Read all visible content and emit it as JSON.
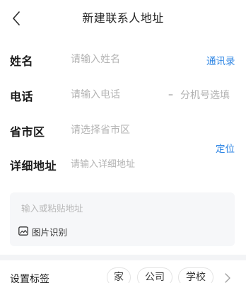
{
  "header": {
    "title": "新建联系人地址"
  },
  "form": {
    "name": {
      "label": "姓名",
      "placeholder": "请输入姓名",
      "contacts_link": "通讯录"
    },
    "phone": {
      "label": "电话",
      "placeholder": "请输入电话",
      "extension_dash": "–",
      "extension_placeholder": "分机号选填"
    },
    "region": {
      "label": "省市区",
      "placeholder": "请选择省市区"
    },
    "locate_link": "定位",
    "address": {
      "label": "详细地址",
      "placeholder": "请输入详细地址"
    }
  },
  "paste": {
    "placeholder": "输入或粘贴地址",
    "image_recognize_label": "图片识别"
  },
  "tags": {
    "label": "设置标签",
    "options": [
      "家",
      "公司",
      "学校"
    ]
  },
  "colors": {
    "accent": "#2f86e4",
    "placeholder": "#b3b3b3",
    "paste_bg": "#f6f7f9",
    "band_bg": "#f3f4f6"
  },
  "icons": {
    "back": "chevron-left-icon",
    "image": "image-icon",
    "more": "chevron-right-icon"
  }
}
